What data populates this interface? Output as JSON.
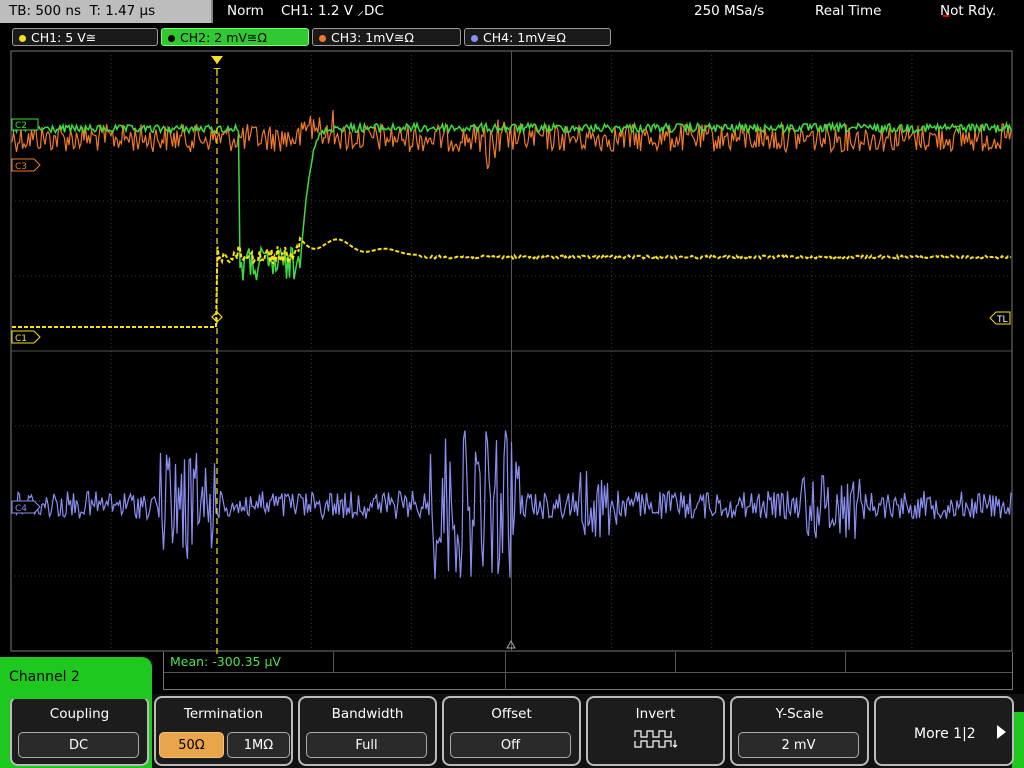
{
  "status": {
    "timebase": "TB: 500 ns",
    "trigger_time": "T: 1.47 µs",
    "mode": "Norm",
    "trigger": "CH1: 1.2 V ⸝DC",
    "sample_rate": "250 MSa/s",
    "acquisition": "Real Time",
    "ready": "Not Rdy."
  },
  "channels": [
    {
      "label": "CH1: 5 V≅",
      "color": "#f5e21a"
    },
    {
      "label": "CH2: 2 mV≅Ω",
      "color": "#3fdc3f"
    },
    {
      "label": "CH3: 1mV≅Ω",
      "color": "#f07a2a"
    },
    {
      "label": "CH4: 1mV≅Ω",
      "color": "#8a8ef0"
    }
  ],
  "markers": {
    "c1": "C1",
    "c2": "C2",
    "c3": "C3",
    "c4": "C4",
    "trigger_level": "TL",
    "trigger_pos": "T"
  },
  "measurement": {
    "mean": "Mean: -300.35 µV"
  },
  "menu_title": "Channel 2",
  "menu": {
    "coupling_label": "Coupling",
    "coupling_value": "DC",
    "termination_label": "Termination",
    "termination_opt1": "50Ω",
    "termination_opt2": "1MΩ",
    "bandwidth_label": "Bandwidth",
    "bandwidth_value": "Full",
    "offset_label": "Offset",
    "offset_value": "Off",
    "invert_label": "Invert",
    "yscale_label": "Y-Scale",
    "yscale_value": "2 mV",
    "more_label": "More 1|2"
  }
}
